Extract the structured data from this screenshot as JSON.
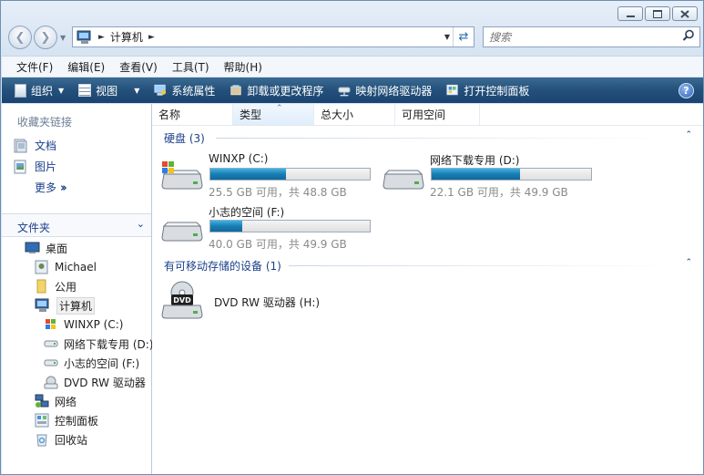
{
  "window": {
    "address_crumb": "计算机",
    "search_placeholder": "搜索"
  },
  "menubar": [
    "文件(F)",
    "编辑(E)",
    "查看(V)",
    "工具(T)",
    "帮助(H)"
  ],
  "toolbar": {
    "organize": "组织",
    "views": "视图",
    "system_properties": "系统属性",
    "uninstall": "卸载或更改程序",
    "map_drive": "映射网络驱动器",
    "control_panel": "打开控制面板"
  },
  "left": {
    "favorites_title": "收藏夹链接",
    "favorites": [
      "文档",
      "图片"
    ],
    "more": "更多",
    "folders_title": "文件夹",
    "tree": [
      "桌面",
      "Michael",
      "公用",
      "计算机",
      "WINXP (C:)",
      "网络下载专用 (D:)",
      "小志的空间 (F:)",
      "DVD RW 驱动器",
      "网络",
      "控制面板",
      "回收站"
    ]
  },
  "columns": [
    "名称",
    "类型",
    "总大小",
    "可用空间"
  ],
  "groups": {
    "hdd": "硬盘 (3)",
    "removable": "有可移动存储的设备 (1)"
  },
  "drives": [
    {
      "name": "WINXP (C:)",
      "free_text": "25.5 GB 可用，共 48.8 GB",
      "used_fraction": 0.477
    },
    {
      "name": "网络下载专用 (D:)",
      "free_text": "22.1 GB 可用，共 49.9 GB",
      "used_fraction": 0.557
    },
    {
      "name": "小志的空间 (F:)",
      "free_text": "40.0 GB 可用，共 49.9 GB",
      "used_fraction": 0.198
    }
  ],
  "dvd": {
    "name": "DVD RW 驱动器 (H:)"
  },
  "colors": {
    "toolbar": "#23507a",
    "link": "#1a3f8a",
    "bar_fill": "#1a7db3"
  }
}
